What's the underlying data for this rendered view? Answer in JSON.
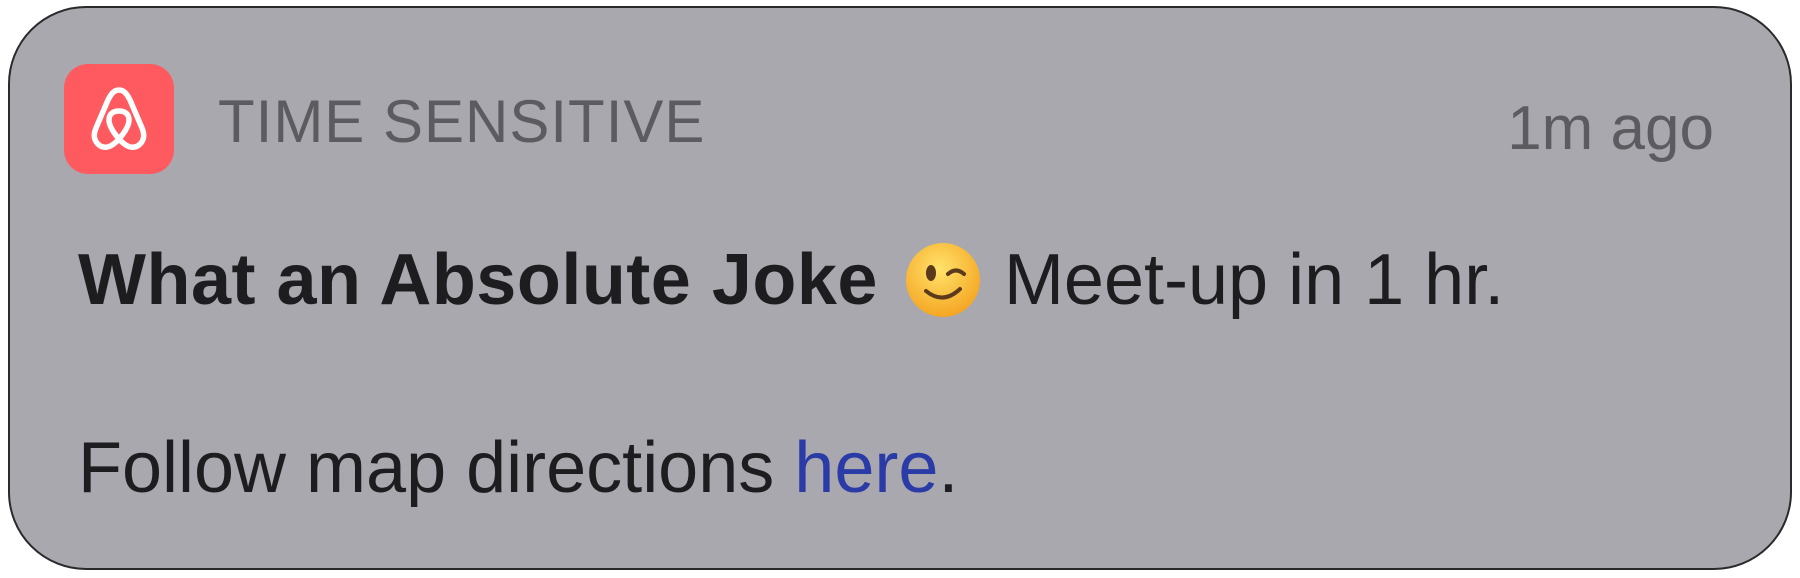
{
  "notification": {
    "app_icon": "airbnb-logo-icon",
    "icon_color": "#ff5a5f",
    "background_color": "#a9a8ae",
    "category": "TIME SENSITIVE",
    "timestamp": "1m ago",
    "title": "What an Absolute Joke",
    "emoji_icon": "winking-face-emoji",
    "message": "Meet-up in 1 hr.",
    "body_prefix": "Follow map directions ",
    "link_text": "here",
    "body_suffix": ".",
    "link_color": "#2a3aa6"
  }
}
